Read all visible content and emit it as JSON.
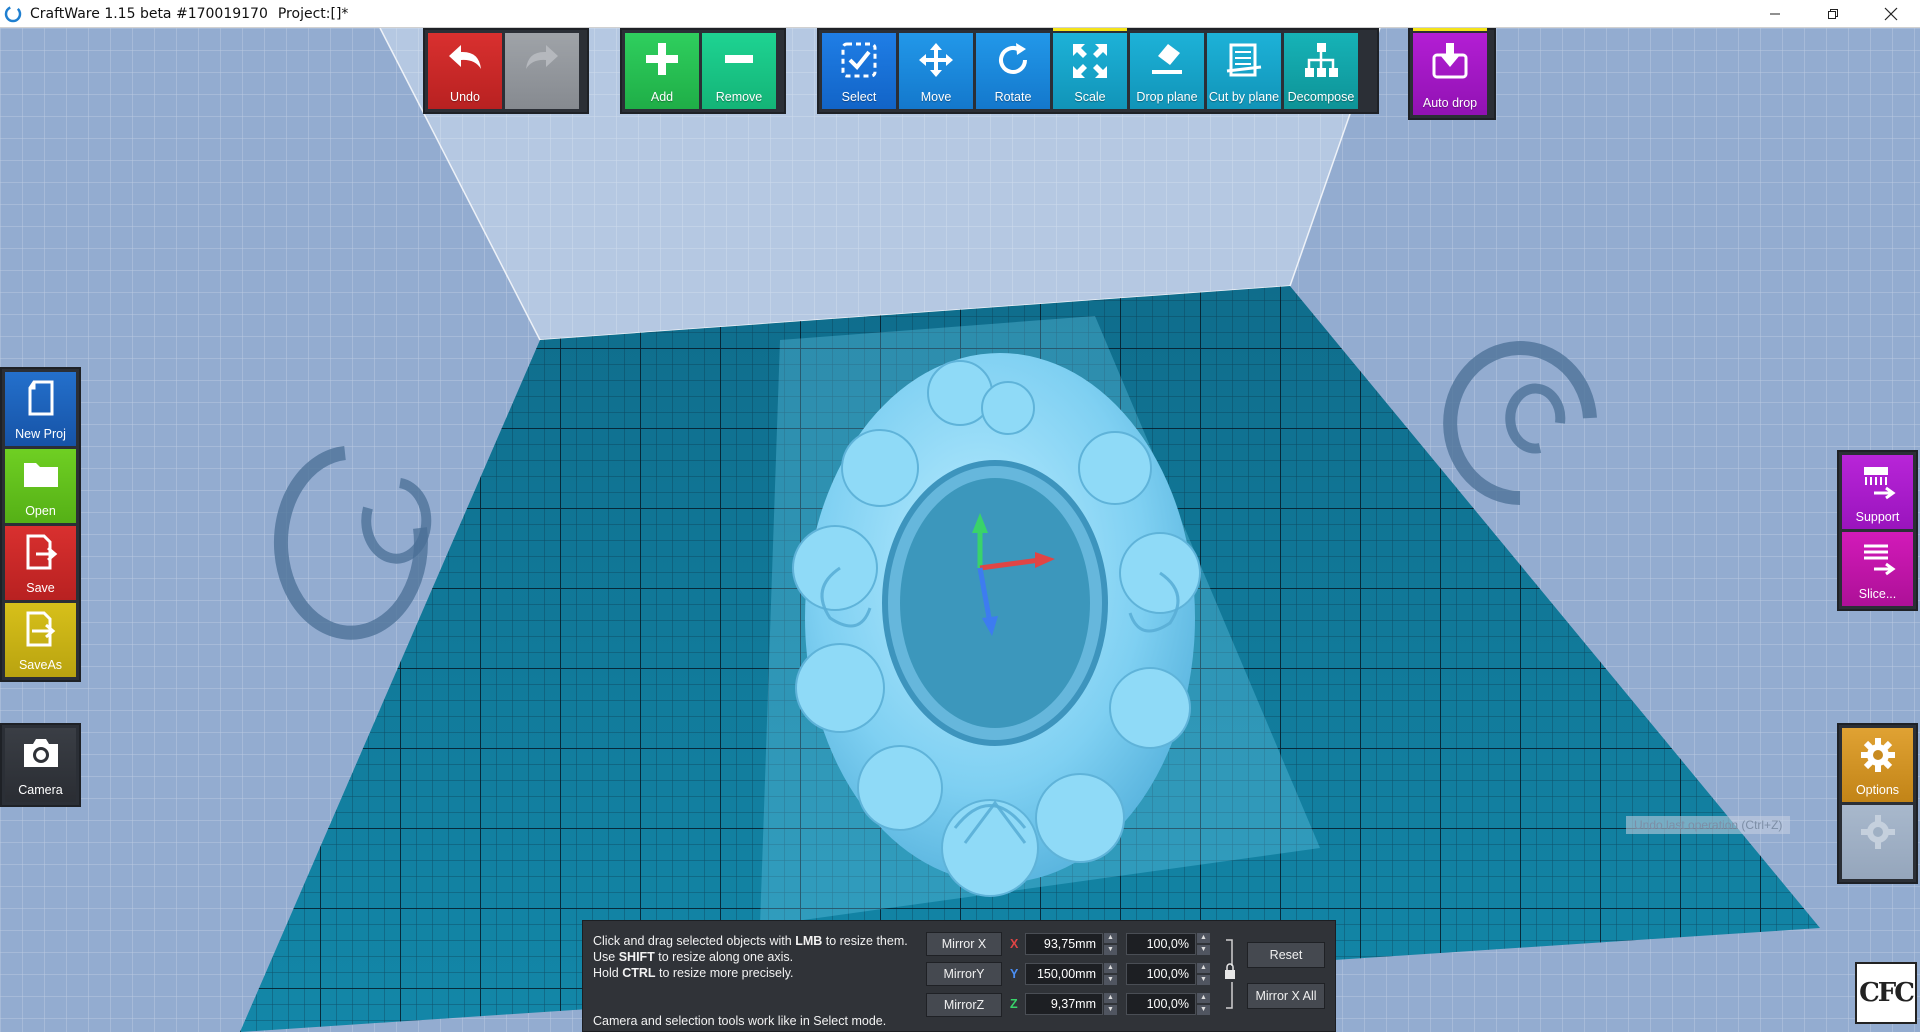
{
  "window": {
    "title": "CraftWare 1.15 beta #170019170",
    "project": "Project:[]*",
    "controls": [
      "minimize-icon",
      "restore-icon",
      "close-icon"
    ]
  },
  "toolbar": {
    "undo": "Undo",
    "redo": "",
    "add": "Add",
    "remove": "Remove",
    "select": "Select",
    "move": "Move",
    "rotate": "Rotate",
    "scale": "Scale",
    "drop_plane": "Drop plane",
    "cut_by_plane": "Cut by plane",
    "decompose": "Decompose",
    "auto_drop": "Auto drop",
    "active_tool": "Scale"
  },
  "left_panel": {
    "new_proj": "New Proj",
    "open": "Open",
    "save": "Save",
    "save_as": "SaveAs",
    "camera": "Camera"
  },
  "right_panel": {
    "support": "Support",
    "slice": "Slice...",
    "options": "Options"
  },
  "tooltip": "Undo last operation (Ctrl+Z)",
  "scale_panel": {
    "help_line1_a": "Click and drag selected objects with ",
    "help_line1_b": "LMB",
    "help_line1_c": " to resize them.",
    "help_line2_a": "Use ",
    "help_line2_b": "SHIFT",
    "help_line2_c": " to resize along one axis.",
    "help_line3_a": "Hold ",
    "help_line3_b": "CTRL",
    "help_line3_c": " to resize more precisely.",
    "help_footer": "Camera and selection tools work like in Select mode.",
    "mirror_x": "Mirror X",
    "mirror_y": "MirrorY",
    "mirror_z": "MirrorZ",
    "axis_x": "X",
    "axis_y": "Y",
    "axis_z": "Z",
    "size_x": "93,75mm",
    "size_y": "150,00mm",
    "size_z": "9,37mm",
    "pct_x": "100,0%",
    "pct_y": "100,0%",
    "pct_z": "100,0%",
    "reset": "Reset",
    "mirror_x_all": "Mirror X All"
  },
  "watermark": "CFC",
  "colors": {
    "undo": "#c62828",
    "add": "#27c152",
    "select": "#1a72d9",
    "scale_active": "#f4e31b",
    "auto_drop": "#a318c4",
    "axis_x": "#e04545",
    "axis_y": "#39d36a",
    "axis_z": "#3d7cf0"
  }
}
